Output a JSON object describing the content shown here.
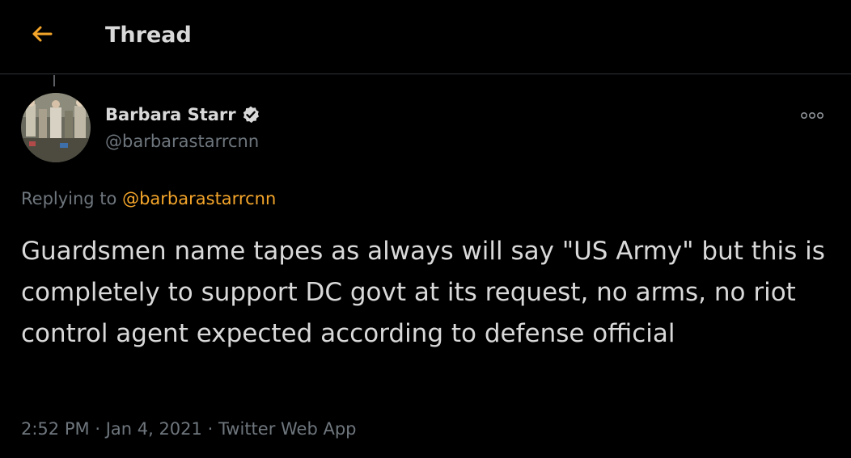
{
  "header": {
    "title": "Thread",
    "back_icon": "arrow-left-icon",
    "accent_color": "#f4a52a"
  },
  "tweet": {
    "author_name": "Barbara Starr",
    "verified_icon": "verified-badge-icon",
    "handle": "@barbarastarrcnn",
    "more_icon": "more-options-icon",
    "replying_prefix": "Replying to",
    "replying_to": "@barbarastarrcnn",
    "text": "Guardsmen name tapes as always will say \"US Army\" but this is completely to support DC govt at its request, no arms, no riot control agent expected according to defense official",
    "time": "2:52 PM",
    "sep1": "·",
    "date": "Jan 4, 2021",
    "sep2": "·",
    "source": "Twitter Web App"
  }
}
